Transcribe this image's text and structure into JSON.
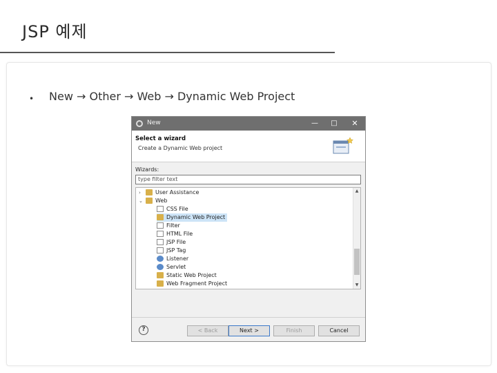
{
  "slide": {
    "title": "JSP 예제",
    "bullet": "•",
    "bullet_text": "New → Other → Web → Dynamic Web Project"
  },
  "dialog": {
    "window_title": "New",
    "window_controls": {
      "minimize": "—",
      "maximize": "□",
      "close": "✕"
    },
    "banner_title": "Select a wizard",
    "banner_desc": "Create a Dynamic Web project",
    "wizards_label": "Wizards:",
    "filter_placeholder": "type filter text",
    "tree": [
      {
        "label": "User Assistance",
        "expander": "›",
        "icon": "folder-icon"
      },
      {
        "label": "Web",
        "expander": "⌄",
        "icon": "folder-icon"
      },
      {
        "label": "CSS File",
        "icon": "file-icon"
      },
      {
        "label": "Dynamic Web Project",
        "icon": "project-icon",
        "selected": true
      },
      {
        "label": "Filter",
        "icon": "file-icon"
      },
      {
        "label": "HTML File",
        "icon": "file-icon"
      },
      {
        "label": "JSP File",
        "icon": "file-icon"
      },
      {
        "label": "JSP Tag",
        "icon": "file-icon"
      },
      {
        "label": "Listener",
        "icon": "gear-icon"
      },
      {
        "label": "Servlet",
        "icon": "gear-icon"
      },
      {
        "label": "Static Web Project",
        "icon": "project-icon"
      },
      {
        "label": "Web Fragment Project",
        "icon": "project-icon"
      }
    ],
    "scroll": {
      "up": "▲",
      "down": "▼"
    },
    "help": "?",
    "buttons": {
      "back": "< Back",
      "next": "Next >",
      "finish": "Finish",
      "cancel": "Cancel"
    }
  }
}
